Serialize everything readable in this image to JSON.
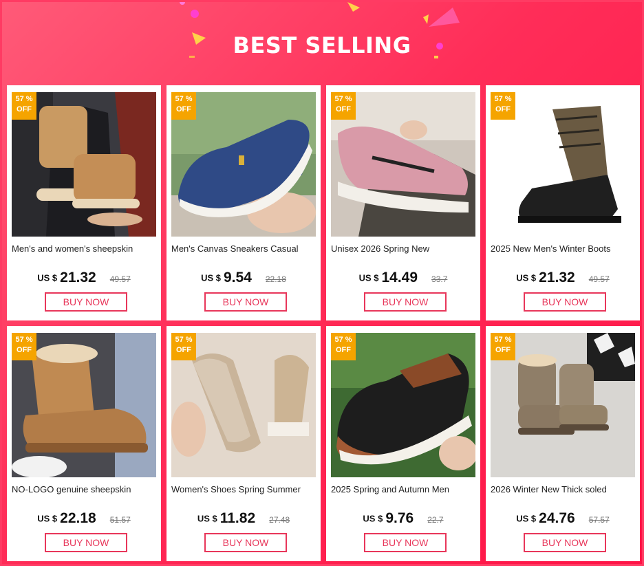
{
  "banner": {
    "title": "BEST SELLING"
  },
  "colors": {
    "accent": "#ff2d58",
    "badge": "#f5a400",
    "button": "#e8365a"
  },
  "currency": "US $",
  "buy_label": "BUY NOW",
  "products": [
    {
      "discount_pct": "57 %",
      "discount_off": "OFF",
      "name": "Men's and women's sheepskin",
      "price": "21.32",
      "old_price": "49.57",
      "image": "sheepskin-boots-photo"
    },
    {
      "discount_pct": "57 %",
      "discount_off": "OFF",
      "name": "Men's Canvas Sneakers Casual",
      "price": "9.54",
      "old_price": "22.18",
      "image": "navy-canvas-slip-on-photo"
    },
    {
      "discount_pct": "57 %",
      "discount_off": "OFF",
      "name": "Unisex 2026 Spring New",
      "price": "14.49",
      "old_price": "33.7",
      "image": "pink-knit-sneaker-photo"
    },
    {
      "discount_pct": "57 %",
      "discount_off": "OFF",
      "name": "2025 New Men's Winter Boots",
      "price": "21.32",
      "old_price": "49.57",
      "image": "camo-winter-boot-photo"
    },
    {
      "discount_pct": "57 %",
      "discount_off": "OFF",
      "name": "NO-LOGO genuine sheepskin",
      "price": "22.18",
      "old_price": "51.57",
      "image": "tan-sheepskin-boot-photo"
    },
    {
      "discount_pct": "57 %",
      "discount_off": "OFF",
      "name": "Women's Shoes Spring Summer",
      "price": "11.82",
      "old_price": "27.48",
      "image": "beige-knit-flats-photo"
    },
    {
      "discount_pct": "57 %",
      "discount_off": "OFF",
      "name": "2025 Spring and Autumn Men",
      "price": "9.76",
      "old_price": "22.7",
      "image": "black-brown-slip-on-photo"
    },
    {
      "discount_pct": "57 %",
      "discount_off": "OFF",
      "name": "2026 Winter New Thick soled",
      "price": "24.76",
      "old_price": "57.57",
      "image": "grey-snow-boots-photo"
    }
  ]
}
